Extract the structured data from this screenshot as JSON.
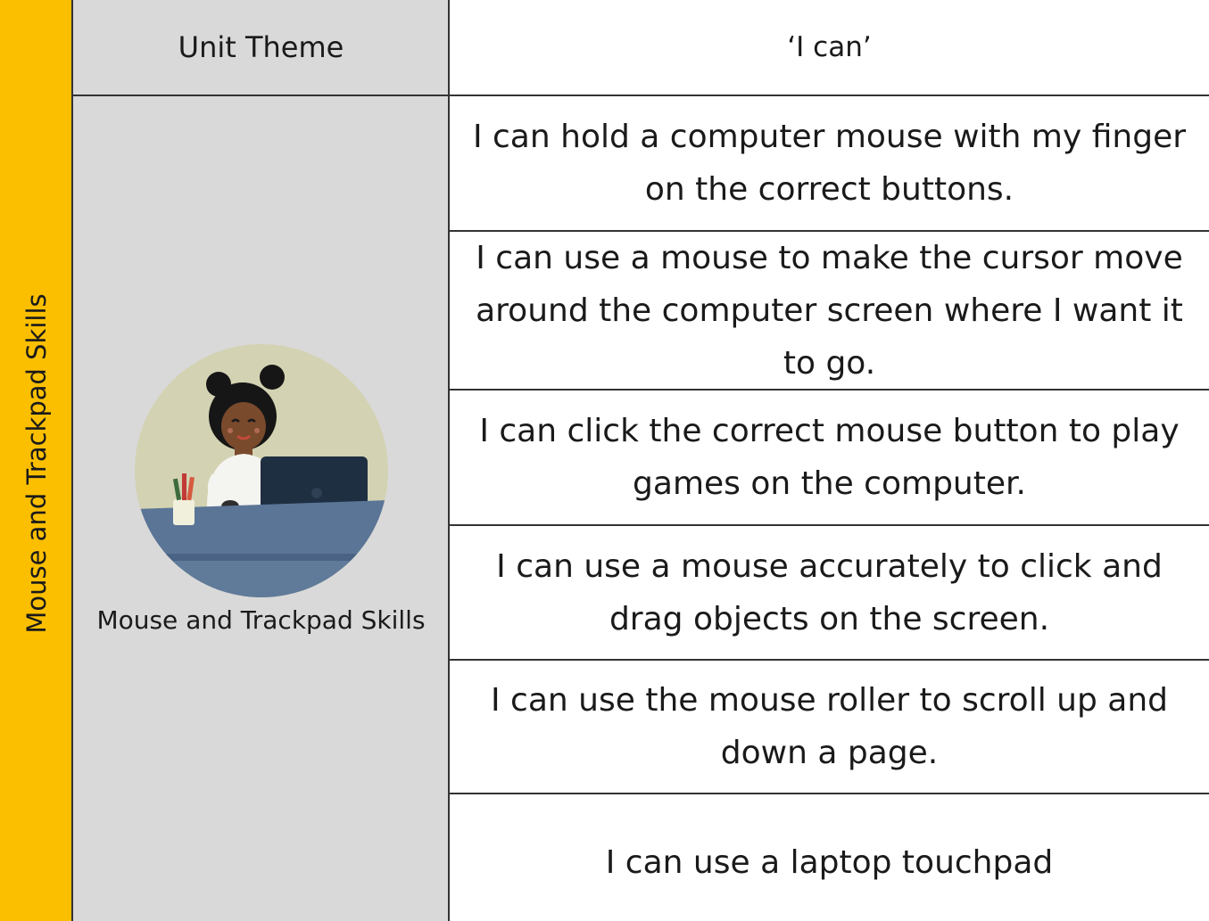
{
  "side_band": {
    "label": "Mouse and Trackpad Skills",
    "color": "#fcbf00"
  },
  "theme": {
    "header": "Unit Theme",
    "label": "Mouse and Trackpad Skills",
    "background": "#d9d9d9",
    "illustration": "girl-at-laptop-illustration"
  },
  "i_can": {
    "header": "‘I can’",
    "items": [
      "I can hold a computer mouse with my finger on the correct buttons.",
      "I can use a mouse to make the cursor move around the computer screen where I want it to go.",
      "I can click the correct mouse button to play games on the computer.",
      "I can use a mouse accurately to click and drag objects on the screen.",
      "I can use the mouse roller to scroll up and down a page.",
      "I can use a laptop touchpad"
    ]
  }
}
